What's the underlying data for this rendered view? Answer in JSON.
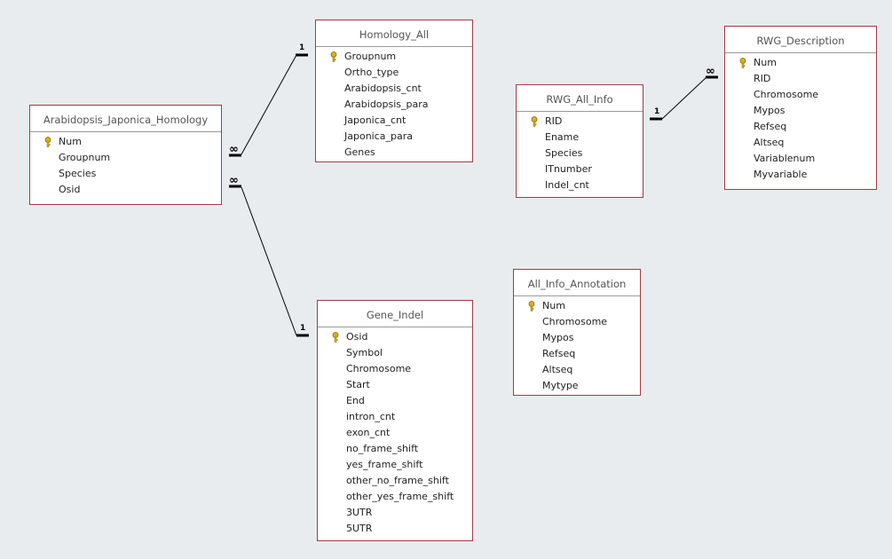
{
  "colors": {
    "background": "#e8ecef",
    "table_border": "#a23a45",
    "key_icon": "#d8b020"
  },
  "tables": [
    {
      "id": "t0",
      "title": "Arabidopsis_Japonica_Homology",
      "fields": [
        "Num",
        "Groupnum",
        "Species",
        "Osid"
      ],
      "primary_key": "Num"
    },
    {
      "id": "t1",
      "title": "Homology_All",
      "fields": [
        "Groupnum",
        "Ortho_type",
        "Arabidopsis_cnt",
        "Arabidopsis_para",
        "Japonica_cnt",
        "Japonica_para",
        "Genes"
      ],
      "primary_key": "Groupnum"
    },
    {
      "id": "t2",
      "title": "RWG_All_Info",
      "fields": [
        "RID",
        "Ename",
        "Species",
        "ITnumber",
        "Indel_cnt"
      ],
      "primary_key": "RID"
    },
    {
      "id": "t3",
      "title": "RWG_Description",
      "fields": [
        "Num",
        "RID",
        "Chromosome",
        "Mypos",
        "Refseq",
        "Altseq",
        "Variablenum",
        "Myvariable"
      ],
      "primary_key": "Num"
    },
    {
      "id": "t4",
      "title": "All_Info_Annotation",
      "fields": [
        "Num",
        "Chromosome",
        "Mypos",
        "Refseq",
        "Altseq",
        "Mytype"
      ],
      "primary_key": "Num"
    },
    {
      "id": "t5",
      "title": "Gene_Indel",
      "fields": [
        "Osid",
        "Symbol",
        "Chromosome",
        "Start",
        "End",
        "intron_cnt",
        "exon_cnt",
        "no_frame_shift",
        "yes_frame_shift",
        "other_no_frame_shift",
        "other_yes_frame_shift",
        "3UTR",
        "5UTR"
      ],
      "primary_key": "Osid"
    }
  ],
  "relationships": [
    {
      "from": "Arabidopsis_Japonica_Homology.Groupnum",
      "to": "Homology_All.Groupnum",
      "from_card": "∞",
      "to_card": "1"
    },
    {
      "from": "Arabidopsis_Japonica_Homology.Osid",
      "to": "Gene_Indel.Osid",
      "from_card": "∞",
      "to_card": "1"
    },
    {
      "from": "RWG_All_Info.RID",
      "to": "RWG_Description.RID",
      "from_card": "1",
      "to_card": "∞"
    }
  ]
}
